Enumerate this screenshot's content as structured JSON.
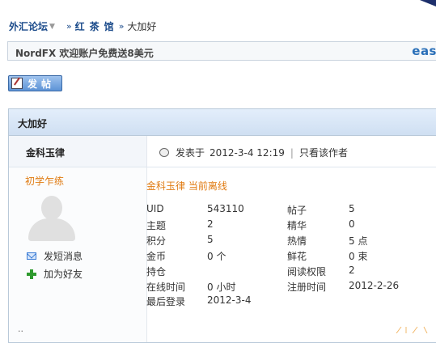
{
  "breadcrumb": {
    "home": "外汇论坛",
    "dropdown_icon": "▼",
    "sep": "»",
    "section": "红茶馆",
    "sep2": "»",
    "current": "大加好"
  },
  "ad": {
    "text": "NordFX 欢迎账户免费送8美元",
    "brand": "eas"
  },
  "post_button": {
    "label": "发帖"
  },
  "post": {
    "title": "大加好",
    "author": "金科玉律",
    "posted_prefix": "发表于",
    "posted_time": "2012-3-4 12:19",
    "pipe": "|",
    "only_author": "只看该作者",
    "rank": "初学乍练",
    "send_msg": "发短消息",
    "add_friend": "加为好友",
    "profile_heading": "金科玉律 当前离线",
    "stats_left": [
      {
        "label": "UID",
        "value": "543110"
      },
      {
        "label": "主题",
        "value": "2"
      },
      {
        "label": "积分",
        "value": "5"
      },
      {
        "label": "金币",
        "value": "0 个"
      },
      {
        "label": "持仓",
        "value": ""
      },
      {
        "label": "在线时间",
        "value": "0 小时"
      },
      {
        "label": "最后登录",
        "value": "2012-3-4"
      }
    ],
    "stats_right": [
      {
        "label": "帖子",
        "value": "5"
      },
      {
        "label": "精华",
        "value": "0"
      },
      {
        "label": "热情",
        "value": "5 点"
      },
      {
        "label": "鲜花",
        "value": "0 束"
      },
      {
        "label": "阅读权限",
        "value": "2"
      },
      {
        "label": "注册时间",
        "value": "2012-2-26"
      }
    ]
  },
  "colors": {
    "link_blue": "#1a4a8a",
    "rank_orange": "#e07b12",
    "title_bar": "#cfdff2"
  }
}
